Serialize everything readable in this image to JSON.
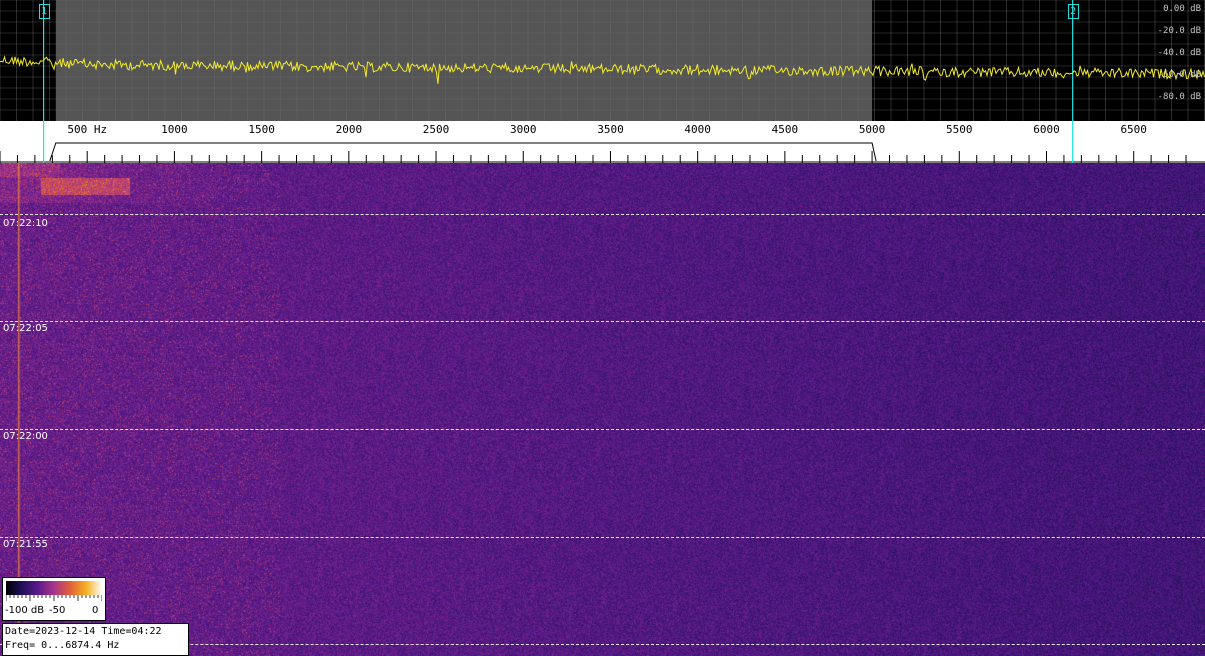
{
  "spectrum": {
    "markers": [
      "1",
      "2"
    ],
    "db_labels": [
      "0.00 dB",
      "-20.0 dB",
      "-40.0 dB",
      "-60.0 dB",
      "-80.0 dB"
    ],
    "colors": {
      "trace": "#f2ec2a",
      "passband": "#555555",
      "marker": "#22e0e0",
      "grid": "#3a3a3a"
    }
  },
  "frequency_axis": {
    "unit": "Hz",
    "ticks": [
      "500 Hz",
      "1000",
      "1500",
      "2000",
      "2500",
      "3000",
      "3500",
      "4000",
      "4500",
      "5000",
      "5500",
      "6000",
      "6500"
    ],
    "tick_values_hz": [
      500,
      1000,
      1500,
      2000,
      2500,
      3000,
      3500,
      4000,
      4500,
      5000,
      5500,
      6000,
      6500
    ],
    "max_hz": 6874.4,
    "passband_hz": [
      320,
      5000
    ],
    "marker_hz": [
      250,
      6150
    ]
  },
  "waterfall": {
    "time_labels": [
      "07:22:10",
      "07:22:05",
      "07:22:00",
      "07:21:55"
    ],
    "colormap": [
      "#000000",
      "#20105a",
      "#5a1a8a",
      "#a8348a",
      "#e0603a",
      "#f5b020",
      "#ffffff"
    ]
  },
  "legend": {
    "min_label": "-100 dB",
    "mid_label": "-50",
    "max_label": "0"
  },
  "info": {
    "line1": "Date=2023-12-14 Time=04:22",
    "line2": "Freq= 0...6874.4 Hz"
  }
}
